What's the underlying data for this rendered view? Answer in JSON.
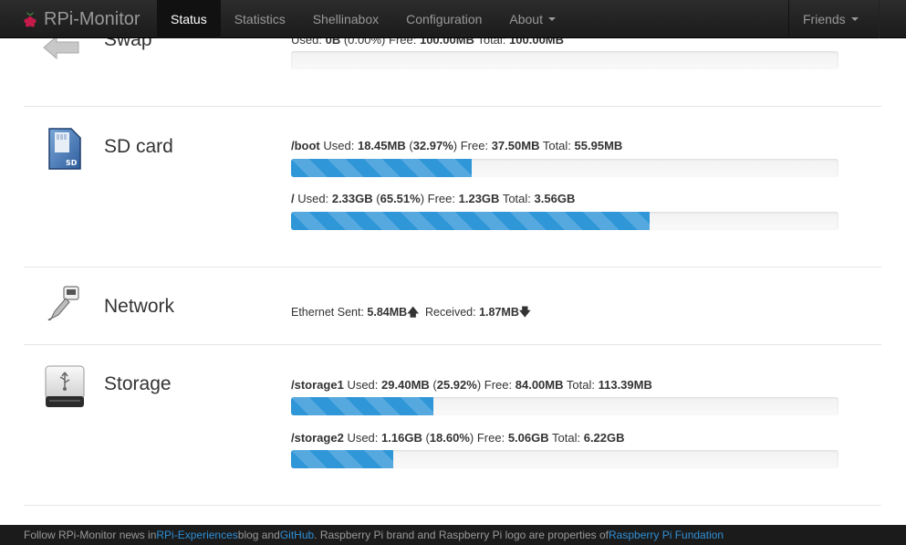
{
  "navbar": {
    "brand": "RPi-Monitor",
    "items": [
      {
        "label": "Status",
        "active": true
      },
      {
        "label": "Statistics"
      },
      {
        "label": "Shellinabox"
      },
      {
        "label": "Configuration"
      },
      {
        "label": "About"
      }
    ],
    "friends": "Friends"
  },
  "swap": {
    "title": "Swap",
    "line": {
      "label_used": "Used:",
      "used": "0B",
      "pct": "(0.00%)",
      "label_free": "Free:",
      "free": "100.00MB",
      "label_total": "Total:",
      "total": "100.00MB"
    },
    "fraction": 0.0
  },
  "sdcard": {
    "title": "SD card",
    "mounts": [
      {
        "mount": "/boot",
        "label_used": "Used:",
        "used": "18.45MB",
        "pct": "32.97%",
        "label_free": "Free:",
        "free": "37.50MB",
        "label_total": "Total:",
        "total": "55.95MB",
        "fraction": 0.3297
      },
      {
        "mount": "/",
        "label_used": "Used:",
        "used": "2.33GB",
        "pct": "65.51%",
        "label_free": "Free:",
        "free": "1.23GB",
        "label_total": "Total:",
        "total": "3.56GB",
        "fraction": 0.6551
      }
    ]
  },
  "network": {
    "title": "Network",
    "label_sent": "Ethernet Sent:",
    "sent": "5.84MB",
    "label_received": "Received:",
    "received": "1.87MB"
  },
  "storage": {
    "title": "Storage",
    "mounts": [
      {
        "mount": "/storage1",
        "label_used": "Used:",
        "used": "29.40MB",
        "pct": "25.92%",
        "label_free": "Free:",
        "free": "84.00MB",
        "label_total": "Total:",
        "total": "113.39MB",
        "fraction": 0.2592
      },
      {
        "mount": "/storage2",
        "label_used": "Used:",
        "used": "1.16GB",
        "pct": "18.60%",
        "label_free": "Free:",
        "free": "5.06GB",
        "label_total": "Total:",
        "total": "6.22GB",
        "fraction": 0.186
      }
    ]
  },
  "footer": {
    "t1": "Follow RPi-Monitor news in ",
    "link1": "RPi-Experiences",
    "t2": " blog and ",
    "link2": "GitHub",
    "t3": ". Raspberry Pi brand and Raspberry Pi logo are properties of ",
    "link3": "Raspberry Pi Fundation"
  },
  "colors": {
    "bar_fill": "#2f96d8",
    "link": "#2f8fd6",
    "navbar_bg": "#1b1b1b"
  }
}
